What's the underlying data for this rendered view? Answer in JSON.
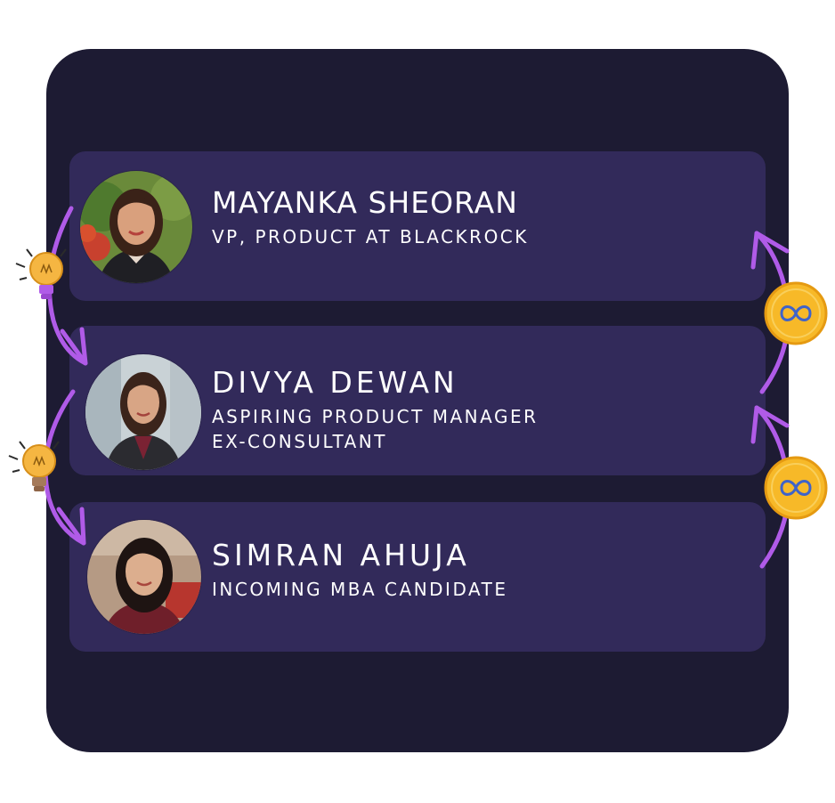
{
  "profiles": [
    {
      "name": "MAYANKA SHEORAN",
      "roles": [
        "VP, PRODUCT AT BLACKROCK"
      ],
      "avatar_icon": "person-photo-icon"
    },
    {
      "name": "DIVYA DEWAN",
      "roles": [
        "ASPIRING PRODUCT MANAGER",
        "EX-CONSULTANT"
      ],
      "avatar_icon": "person-photo-icon"
    },
    {
      "name": "SIMRAN AHUJA",
      "roles": [
        "INCOMING MBA CANDIDATE"
      ],
      "avatar_icon": "person-photo-icon"
    }
  ],
  "decorations": {
    "left_icons": [
      "lightbulb-icon",
      "lightbulb-icon"
    ],
    "right_icons": [
      "infinity-coin-icon",
      "infinity-coin-icon"
    ]
  },
  "colors": {
    "panel": "#1d1b33",
    "card": "#322a5a",
    "arrow": "#b05be8",
    "coin": "#f7b928",
    "bulb": "#f5b642"
  }
}
